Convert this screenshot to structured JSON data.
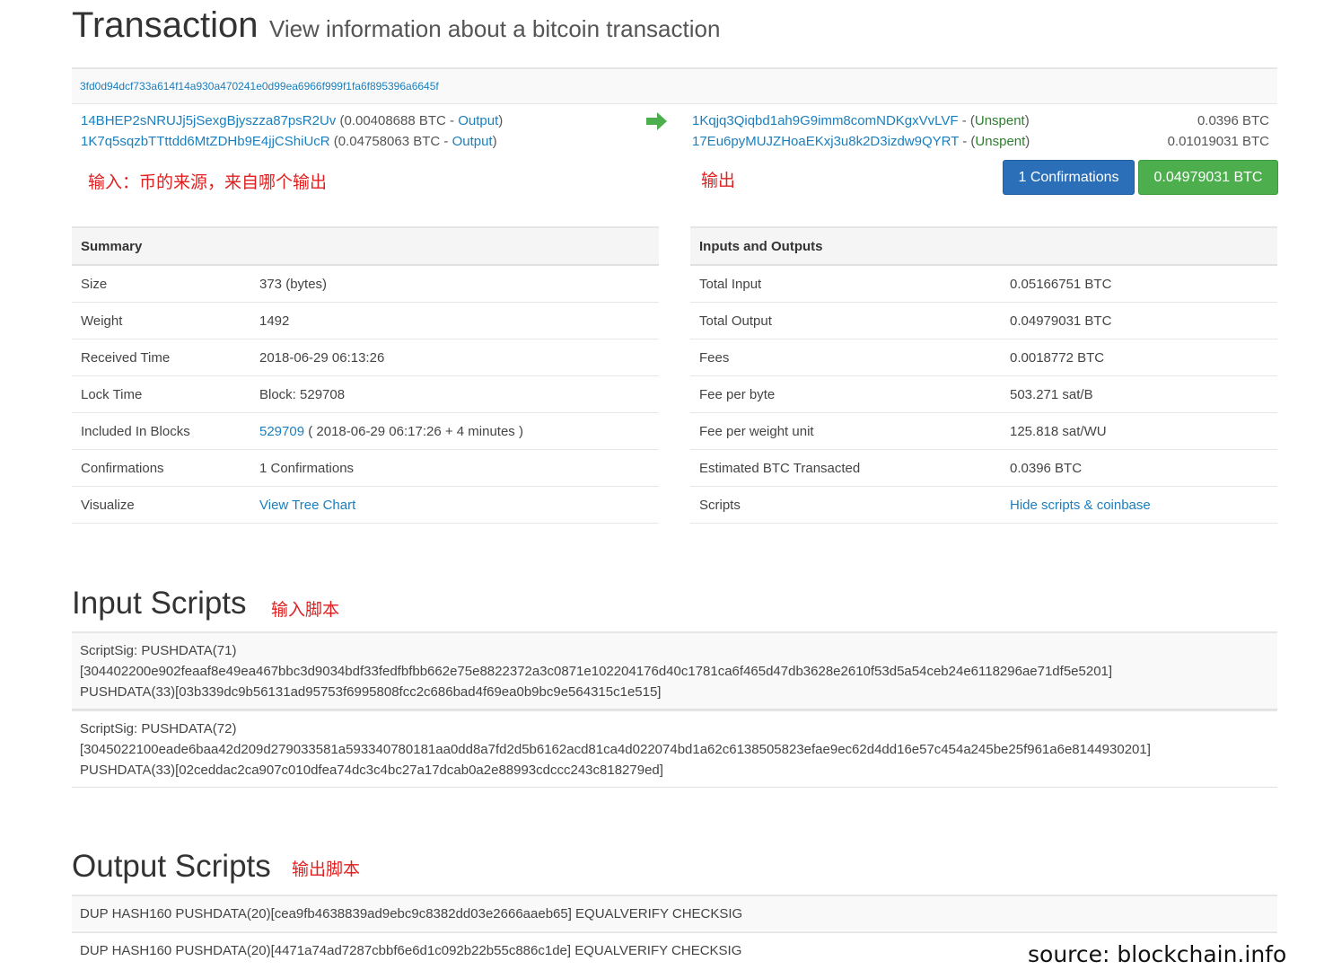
{
  "header": {
    "title": "Transaction",
    "subtitle": "View information about a bitcoin transaction"
  },
  "tx_hash": "3fd0d94dcf733a614f14a930a470241e0d99ea6966f999f1fa6f895396a6645f",
  "inputs": [
    {
      "address": "14BHEP2sNRUJj5jSexgBjyszza87psR2Uv",
      "amount": "(0.00408688 BTC",
      "sep": " - ",
      "link": "Output",
      "close": ")"
    },
    {
      "address": "1K7q5sqzbTTttdd6MtZDHb9E4jjCShiUcR",
      "amount": "(0.04758063 BTC",
      "sep": " - ",
      "link": "Output",
      "close": ")"
    }
  ],
  "outputs": [
    {
      "address": "1Kqjq3Qiqbd1ah9G9imm8comNDKgxVvLVF",
      "sep": " - (",
      "status": "Unspent",
      "close": ")",
      "amount": "0.0396 BTC"
    },
    {
      "address": "17Eu6pyMUJZHoaEKxj3u8k2D3izdw9QYRT",
      "sep": " - (",
      "status": "Unspent",
      "close": ")",
      "amount": "0.01019031 BTC"
    }
  ],
  "buttons": {
    "confirmations": "1 Confirmations",
    "total": "0.04979031 BTC"
  },
  "annotations": {
    "inputs": "输入：币的来源，来自哪个输出",
    "outputs": "输出",
    "input_scripts": "输入脚本",
    "output_scripts": "输出脚本"
  },
  "summary": {
    "heading": "Summary",
    "rows": [
      {
        "label": "Size",
        "value": "373 (bytes)"
      },
      {
        "label": "Weight",
        "value": "1492"
      },
      {
        "label": "Received Time",
        "value": "2018-06-29 06:13:26"
      },
      {
        "label": "Lock Time",
        "value": "Block: 529708"
      },
      {
        "label": "Included In Blocks",
        "link": "529709",
        "value": " ( 2018-06-29 06:17:26 + 4 minutes )"
      },
      {
        "label": "Confirmations",
        "value": "1 Confirmations"
      },
      {
        "label": "Visualize",
        "link": "View Tree Chart"
      }
    ]
  },
  "inputs_outputs": {
    "heading": "Inputs and Outputs",
    "rows": [
      {
        "label": "Total Input",
        "value": "0.05166751 BTC"
      },
      {
        "label": "Total Output",
        "value": "0.04979031 BTC"
      },
      {
        "label": "Fees",
        "value": "0.0018772 BTC"
      },
      {
        "label": "Fee per byte",
        "value": "503.271 sat/B"
      },
      {
        "label": "Fee per weight unit",
        "value": "125.818 sat/WU"
      },
      {
        "label": "Estimated BTC Transacted",
        "value": "0.0396 BTC"
      },
      {
        "label": "Scripts",
        "link": "Hide scripts & coinbase"
      }
    ]
  },
  "input_scripts": {
    "title": "Input Scripts",
    "items": [
      {
        "lines": [
          "ScriptSig: PUSHDATA(71)",
          "[304402200e902feaaf8e49ea467bbc3d9034bdf33fedfbfbb662e75e8822372a3c0871e102204176d40c1781ca6f465d47db3628e2610f53d5a54ceb24e6118296ae71df5e5201]",
          "PUSHDATA(33)[03b339dc9b56131ad95753f6995808fcc2c686bad4f69ea0b9bc9e564315c1e515]"
        ]
      },
      {
        "lines": [
          "ScriptSig: PUSHDATA(72)",
          "[3045022100eade6baa42d209d279033581a593340780181aa0dd8a7fd2d5b6162acd81ca4d022074bd1a62c6138505823efae9ec62d4dd16e57c454a245be25f961a6e8144930201]",
          "PUSHDATA(33)[02ceddac2ca907c010dfea74dc3c4bc27a17dcab0a2e88993cdccc243c818279ed]"
        ]
      }
    ]
  },
  "output_scripts": {
    "title": "Output Scripts",
    "items": [
      "DUP HASH160 PUSHDATA(20)[cea9fb4638839ad9ebc9c8382dd03e2666aaeb65] EQUALVERIFY CHECKSIG",
      "DUP HASH160 PUSHDATA(20)[4471a74ad7287cbbf6e6d1c092b22b55c886c1de] EQUALVERIFY CHECKSIG"
    ]
  },
  "source": "source: blockchain.info",
  "colors": {
    "link": "#1b7fbd",
    "unspent": "#2e7d2e",
    "button_blue": "#2a6fb8",
    "button_green": "#4cae4c",
    "arrow": "#4cae4c",
    "annotation": "#e02020"
  }
}
